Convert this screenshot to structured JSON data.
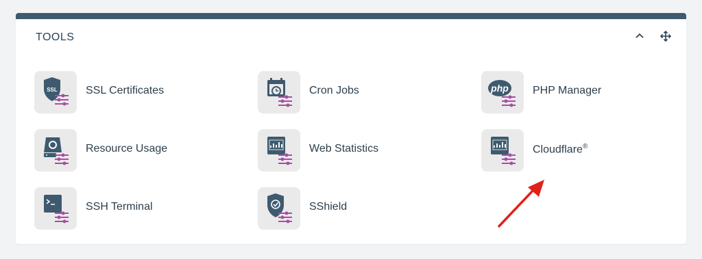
{
  "panel": {
    "title": "TOOLS",
    "accent_color": "#3e5a6e",
    "controls": [
      {
        "icon": "chevron-up-icon"
      },
      {
        "icon": "move-arrows-icon"
      }
    ]
  },
  "tools": [
    {
      "label": "SSL Certificates",
      "icon": "ssl-shield-icon"
    },
    {
      "label": "Cron Jobs",
      "icon": "calendar-clock-icon"
    },
    {
      "label": "PHP Manager",
      "icon": "php-icon"
    },
    {
      "label": "Resource Usage",
      "icon": "hard-drive-icon"
    },
    {
      "label": "Web Statistics",
      "icon": "stats-monitor-icon"
    },
    {
      "label": "Cloudflare",
      "icon": "stats-monitor-icon",
      "mark": "®"
    },
    {
      "label": "SSH Terminal",
      "icon": "terminal-icon"
    },
    {
      "label": "SShield",
      "icon": "shield-check-icon"
    }
  ],
  "colors": {
    "icon_dark": "#3e5a6e",
    "icon_accent": "#a94ca3",
    "annotation_arrow": "#e0211b"
  }
}
